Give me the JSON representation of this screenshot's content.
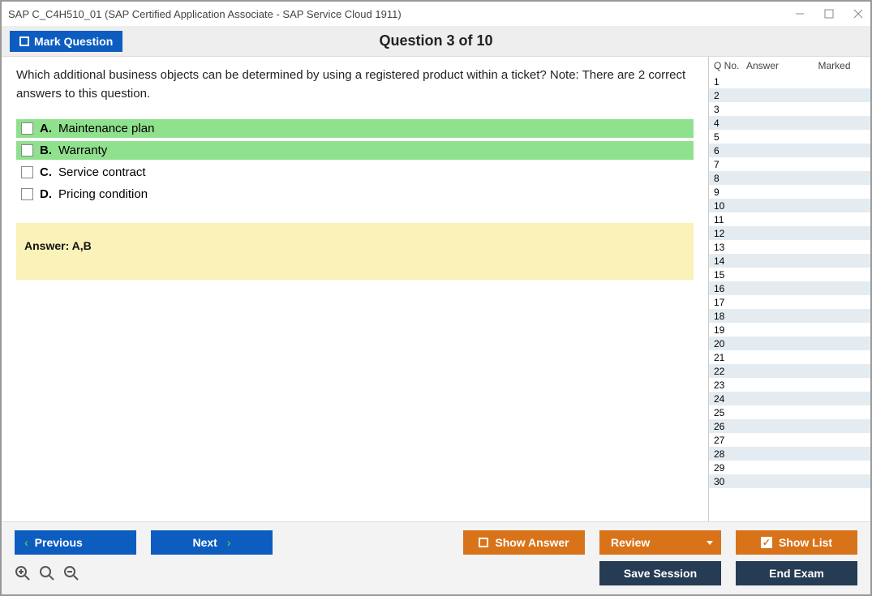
{
  "window": {
    "title": "SAP C_C4H510_01 (SAP Certified Application Associate - SAP Service Cloud 1911)"
  },
  "topbar": {
    "mark_label": "Mark Question",
    "counter": "Question 3 of 10"
  },
  "question": {
    "text": "Which additional business objects can be determined by using a registered product within a ticket? Note: There are 2 correct answers to this question.",
    "choices": [
      {
        "letter": "A.",
        "text": "Maintenance plan",
        "correct": true
      },
      {
        "letter": "B.",
        "text": "Warranty",
        "correct": true
      },
      {
        "letter": "C.",
        "text": "Service contract",
        "correct": false
      },
      {
        "letter": "D.",
        "text": "Pricing condition",
        "correct": false
      }
    ],
    "answer_label": "Answer: A,B"
  },
  "sidebar": {
    "col_qno": "Q No.",
    "col_answer": "Answer",
    "col_marked": "Marked",
    "rows": [
      "1",
      "2",
      "3",
      "4",
      "5",
      "6",
      "7",
      "8",
      "9",
      "10",
      "11",
      "12",
      "13",
      "14",
      "15",
      "16",
      "17",
      "18",
      "19",
      "20",
      "21",
      "22",
      "23",
      "24",
      "25",
      "26",
      "27",
      "28",
      "29",
      "30"
    ]
  },
  "buttons": {
    "previous": "Previous",
    "next": "Next",
    "show_answer": "Show Answer",
    "review": "Review",
    "show_list": "Show List",
    "save_session": "Save Session",
    "end_exam": "End Exam"
  }
}
